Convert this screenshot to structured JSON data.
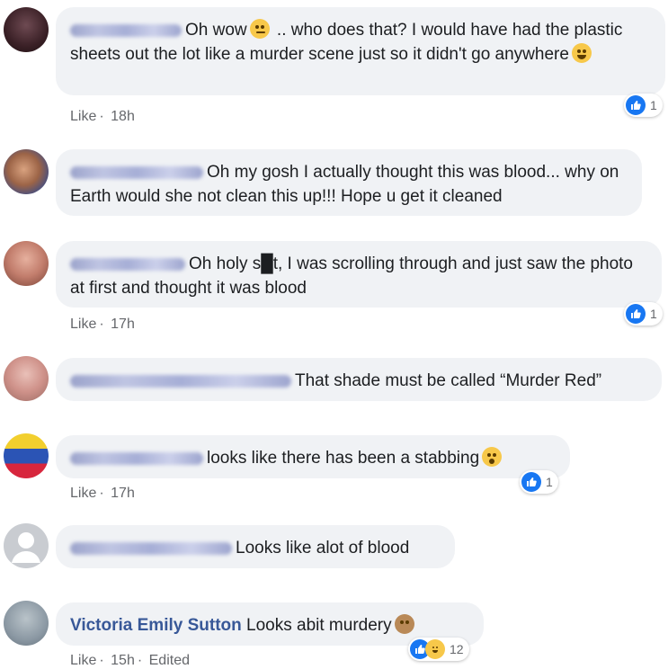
{
  "comments": [
    {
      "text": "Oh wow .. who does that? I would have had the plastic sheets out the lot like a murder scene just so it didn't go anywhere",
      "text_a": "Oh wow",
      "text_b": " .. who does that? I would have had the plastic sheets out the lot like a murder scene just so it didn't go anywhere",
      "emoji_a": "thinking-face",
      "emoji_b": "laughing-face",
      "like_label": "Like",
      "time": "18h",
      "reaction_count": "1"
    },
    {
      "text": "Oh my gosh I actually thought this was blood... why on Earth would she not clean this up!!! Hope u get it cleaned"
    },
    {
      "text": "Oh holy s█t, I was scrolling through and just saw the photo at first and thought it was blood",
      "like_label": "Like",
      "time": "17h",
      "reaction_count": "1"
    },
    {
      "text": "That shade must be called “Murder Red”"
    },
    {
      "text": "looks like there has been a stabbing",
      "emoji": "wow-face",
      "like_label": "Like",
      "time": "17h",
      "reaction_count": "1"
    },
    {
      "text": "Looks like alot of blood"
    },
    {
      "name": "Victoria Emily Sutton",
      "text": " Looks abit murdery",
      "emoji": "see-no-evil-monkey",
      "like_label": "Like",
      "time": "15h",
      "edited": "Edited",
      "reaction_count": "12"
    }
  ],
  "meta_separator": "·",
  "colors": {
    "bubble": "#f0f2f5",
    "name": "#385898",
    "like_blue": "#1877f2",
    "meta_gray": "#65676b"
  }
}
